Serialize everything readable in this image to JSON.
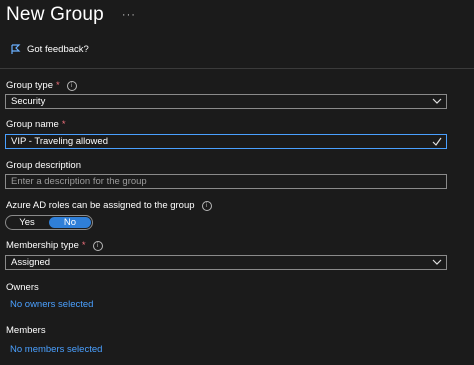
{
  "header": {
    "title": "New Group",
    "more_label": "···"
  },
  "feedback": {
    "label": "Got feedback?"
  },
  "group_type": {
    "label": "Group type",
    "required_mark": "*",
    "value": "Security"
  },
  "group_name": {
    "label": "Group name",
    "required_mark": "*",
    "value": "VIP - Traveling allowed"
  },
  "group_description": {
    "label": "Group description",
    "placeholder": "Enter a description for the group"
  },
  "azure_ad_roles": {
    "label": "Azure AD roles can be assigned to the group",
    "yes": "Yes",
    "no": "No",
    "selected": "No"
  },
  "membership_type": {
    "label": "Membership type",
    "required_mark": "*",
    "value": "Assigned"
  },
  "owners": {
    "label": "Owners",
    "link": "No owners selected"
  },
  "members": {
    "label": "Members",
    "link": "No members selected"
  },
  "colors": {
    "background": "#1b1b1b",
    "accent": "#2f7fd8",
    "link": "#4aa0ff",
    "required": "#f1707b"
  },
  "info_icon_glyph": "i"
}
